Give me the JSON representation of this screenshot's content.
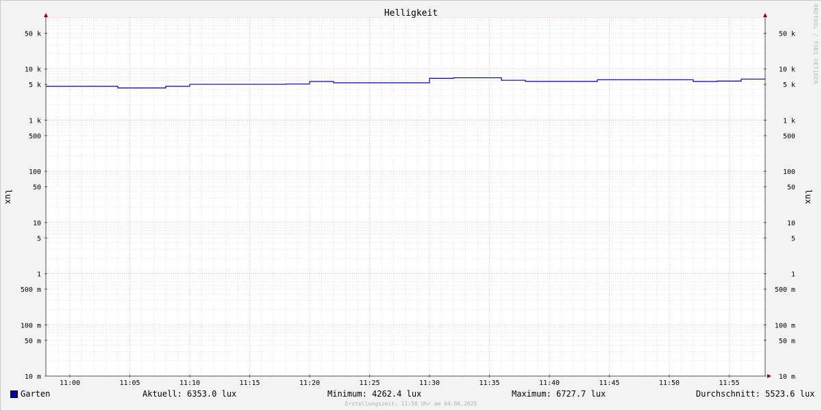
{
  "chart_data": {
    "type": "line",
    "title": "Helligkeit",
    "ylabel": "lux",
    "yscale": "log",
    "ylim": [
      0.01,
      100000
    ],
    "xlim": [
      "10:58",
      "11:58"
    ],
    "y_ticks": [
      {
        "value": 50000,
        "label": "50 k"
      },
      {
        "value": 10000,
        "label": "10 k"
      },
      {
        "value": 5000,
        "label": "5 k"
      },
      {
        "value": 1000,
        "label": "1 k"
      },
      {
        "value": 500,
        "label": "500"
      },
      {
        "value": 100,
        "label": "100"
      },
      {
        "value": 50,
        "label": "50"
      },
      {
        "value": 10,
        "label": "10"
      },
      {
        "value": 5,
        "label": "5"
      },
      {
        "value": 1,
        "label": "1"
      },
      {
        "value": 0.5,
        "label": "500 m"
      },
      {
        "value": 0.1,
        "label": "100 m"
      },
      {
        "value": 0.05,
        "label": "50 m"
      },
      {
        "value": 0.01,
        "label": "10 m"
      }
    ],
    "x_ticks": [
      "11:00",
      "11:05",
      "11:10",
      "11:15",
      "11:20",
      "11:25",
      "11:30",
      "11:35",
      "11:40",
      "11:45",
      "11:50",
      "11:55"
    ],
    "series": [
      {
        "name": "Garten",
        "color": "#0000a0",
        "x": [
          "10:58",
          "11:04",
          "11:08",
          "11:10",
          "11:18",
          "11:20",
          "11:22",
          "11:30",
          "11:32",
          "11:36",
          "11:38",
          "11:44",
          "11:52",
          "11:54",
          "11:56",
          "11:58"
        ],
        "values": [
          4590,
          4262,
          4590,
          5020,
          5080,
          5690,
          5370,
          6560,
          6728,
          6020,
          5710,
          6180,
          5690,
          5800,
          6353,
          6353
        ]
      }
    ]
  },
  "legend": {
    "series_name": "Garten",
    "current": "Aktuell: 6353.0 lux",
    "minimum": "Minimum: 4262.4 lux",
    "maximum": "Maximum: 6727.7 lux",
    "average": "Durchschnitt: 5523.6 lux"
  },
  "watermark": "RRDTOOL / TOBI OETIKER",
  "footer": "Erstellungszeit: 11:58 Uhr am 04.06.2025",
  "colors": {
    "background": "#f3f3f3",
    "plot_background": "#ffffff",
    "major_grid": "#f0a0a0",
    "minor_grid": "#c8c8c8",
    "line": "#0000a0",
    "axis": "#505050",
    "arrow": "#a00000"
  }
}
